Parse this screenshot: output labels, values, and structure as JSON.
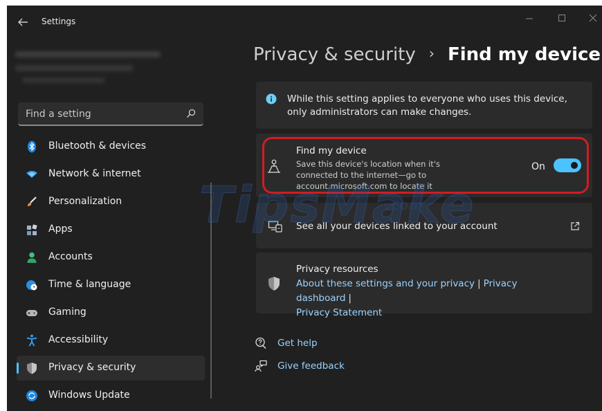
{
  "window": {
    "title": "Settings"
  },
  "search": {
    "placeholder": "Find a setting"
  },
  "sidebar": {
    "items": [
      {
        "label": "Bluetooth & devices",
        "icon": "bluetooth-icon"
      },
      {
        "label": "Network & internet",
        "icon": "wifi-icon"
      },
      {
        "label": "Personalization",
        "icon": "brush-icon"
      },
      {
        "label": "Apps",
        "icon": "apps-icon"
      },
      {
        "label": "Accounts",
        "icon": "person-icon"
      },
      {
        "label": "Time & language",
        "icon": "globe-clock-icon"
      },
      {
        "label": "Gaming",
        "icon": "gamepad-icon"
      },
      {
        "label": "Accessibility",
        "icon": "accessibility-icon"
      },
      {
        "label": "Privacy & security",
        "icon": "shield-icon",
        "selected": true
      },
      {
        "label": "Windows Update",
        "icon": "update-icon"
      }
    ]
  },
  "breadcrumb": {
    "parent": "Privacy & security",
    "separator": "›",
    "current": "Find my device"
  },
  "info_card": {
    "text": "While this setting applies to everyone who uses this device, only administrators can make changes."
  },
  "find_my_device": {
    "title": "Find my device",
    "description": "Save this device's location when it's connected to the internet—go to account.microsoft.com to locate it",
    "toggle_label": "On",
    "toggle_state": true
  },
  "linked_devices": {
    "label": "See all your devices linked to your account"
  },
  "privacy_resources": {
    "title": "Privacy resources",
    "link_about": "About these settings and your privacy",
    "pipe": "|",
    "link_dashboard": "Privacy dashboard",
    "link_statement": "Privacy Statement"
  },
  "help": {
    "get_help": "Get help",
    "give_feedback": "Give feedback"
  },
  "watermark": {
    "text": "TipsMake",
    "suffix": ".com"
  },
  "colors": {
    "background": "#202020",
    "card": "#2b2b2b",
    "accent": "#4cc2ff",
    "link": "#9ad3ff",
    "highlight_border": "#d21c24"
  }
}
